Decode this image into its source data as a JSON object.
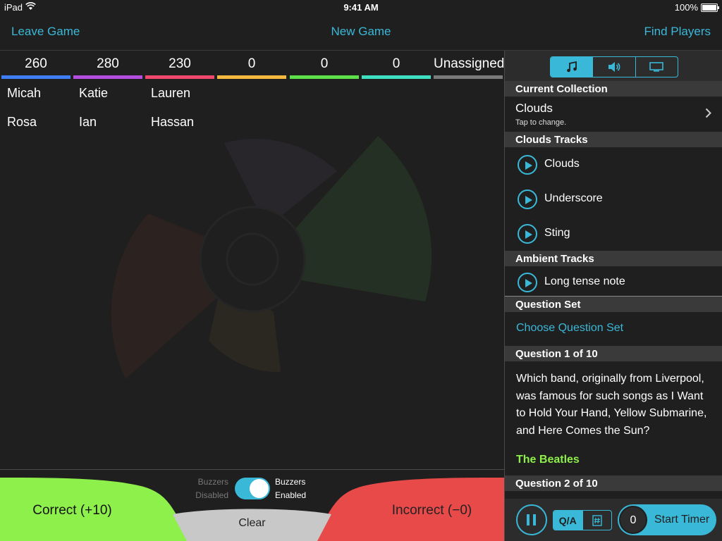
{
  "status": {
    "device": "iPad",
    "time": "9:41 AM",
    "battery": "100%"
  },
  "nav": {
    "leave": "Leave Game",
    "new_game": "New Game",
    "find_players": "Find Players"
  },
  "teams": [
    {
      "score": "260",
      "color": "#3f7df2"
    },
    {
      "score": "280",
      "color": "#b44ee0"
    },
    {
      "score": "230",
      "color": "#f0476d"
    },
    {
      "score": "0",
      "color": "#f5b93f"
    },
    {
      "score": "0",
      "color": "#5ee04a"
    },
    {
      "score": "0",
      "color": "#3ee0c2"
    },
    {
      "score": "Unassigned",
      "color": "#7a7a7a"
    }
  ],
  "players": [
    "Micah",
    "Katie",
    "Lauren",
    "Rosa",
    "Ian",
    "Hassan"
  ],
  "buttons": {
    "correct": "Correct (+10)",
    "incorrect": "Incorrect (−0)",
    "clear": "Clear",
    "buzzers_off_1": "Buzzers",
    "buzzers_off_2": "Disabled",
    "buzzers_on_1": "Buzzers",
    "buzzers_on_2": "Enabled"
  },
  "panel": {
    "current_collection_header": "Current Collection",
    "collection_name": "Clouds",
    "collection_hint": "Tap to change.",
    "tracks_header": "Clouds Tracks",
    "tracks": [
      "Clouds",
      "Underscore",
      "Sting"
    ],
    "ambient_header": "Ambient Tracks",
    "ambient": [
      "Long tense note"
    ],
    "question_set_header": "Question Set",
    "choose_set": "Choose Question Set",
    "q1_header": "Question 1 of 10",
    "q1_text": "Which band, originally from Liverpool, was famous for such songs as I Want to Hold Your Hand, Yellow Submarine, and Here Comes the Sun?",
    "q1_answer": "The Beatles",
    "q2_header": "Question 2 of 10"
  },
  "controls": {
    "qa": "Q/A",
    "timer_value": "0",
    "start_timer": "Start Timer"
  },
  "colors": {
    "accent": "#3ab8d8",
    "correct": "#8ef04a",
    "incorrect": "#e84a4a",
    "clear": "#c8c8c8"
  }
}
